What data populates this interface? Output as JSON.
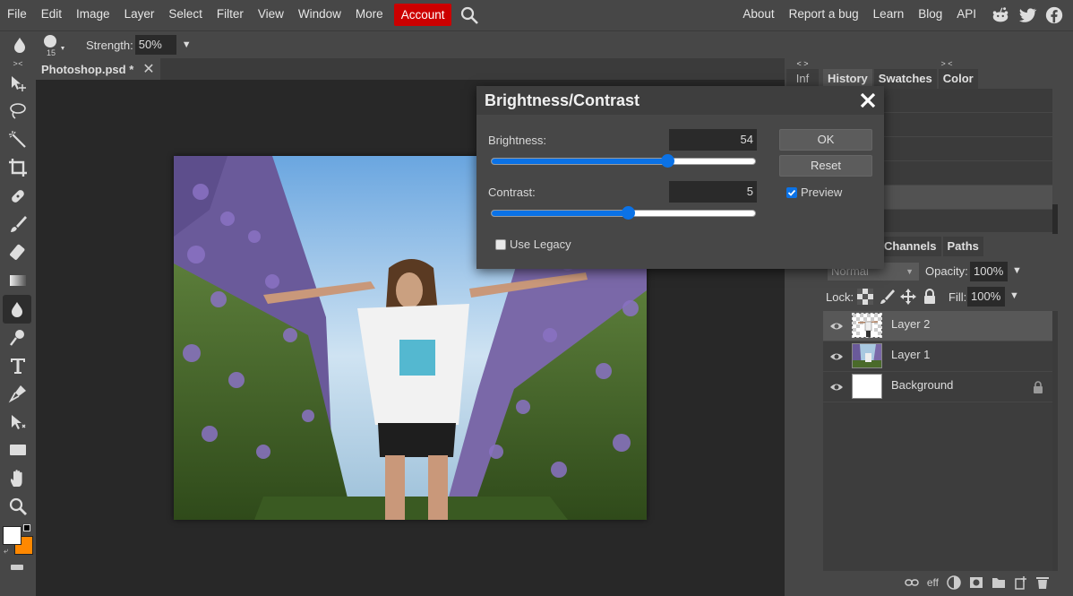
{
  "menu": {
    "items": [
      "File",
      "Edit",
      "Image",
      "Layer",
      "Select",
      "Filter",
      "View",
      "Window",
      "More"
    ],
    "account": "Account",
    "right": [
      "About",
      "Report a bug",
      "Learn",
      "Blog",
      "API"
    ]
  },
  "options": {
    "brush_size": "15",
    "strength_label": "Strength:",
    "strength_value": "50%"
  },
  "document": {
    "tab_title": "Photoshop.psd *"
  },
  "midcol": {
    "label": "Inf"
  },
  "panels": {
    "top_tabs": [
      "History",
      "Swatches",
      "Color"
    ],
    "layer_tabs": [
      "Channels",
      "Paths"
    ],
    "blend_mode": "Normal",
    "opacity_label": "Opacity:",
    "opacity_value": "100%",
    "lock_label": "Lock:",
    "fill_label": "Fill:",
    "fill_value": "100%",
    "layers": [
      {
        "name": "Layer 2"
      },
      {
        "name": "Layer 1"
      },
      {
        "name": "Background"
      }
    ],
    "footer_eff": "eff"
  },
  "dialog": {
    "title": "Brightness/Contrast",
    "brightness_label": "Brightness:",
    "brightness_value": "54",
    "brightness_fraction": 0.67,
    "contrast_label": "Contrast:",
    "contrast_value": "5",
    "contrast_fraction": 0.52,
    "legacy_label": "Use Legacy",
    "legacy_checked": false,
    "preview_label": "Preview",
    "preview_checked": true,
    "ok_label": "OK",
    "reset_label": "Reset"
  },
  "colors": {
    "accent": "#0b72e6",
    "account": "#cc0000",
    "foreground": "#ffffff",
    "background": "#ff8800"
  }
}
